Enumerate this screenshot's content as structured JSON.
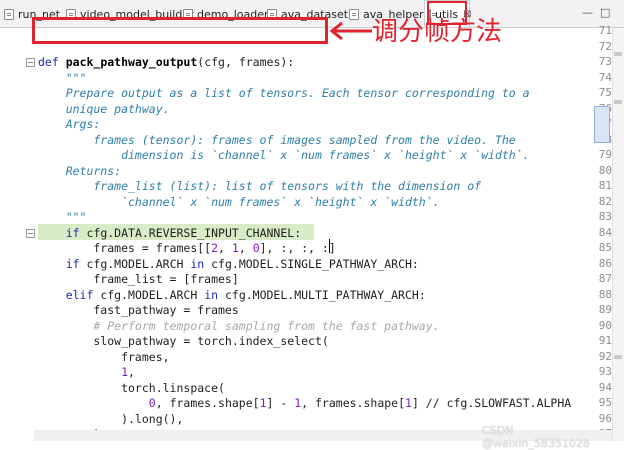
{
  "tabs": [
    {
      "label": "run_net",
      "active": false
    },
    {
      "label": "video_model_builder",
      "active": false
    },
    {
      "label": "demo_loader",
      "active": false
    },
    {
      "label": "ava_dataset",
      "active": false
    },
    {
      "label": "ava_helper",
      "active": false
    },
    {
      "label": "utils",
      "active": true,
      "close": "⊠"
    }
  ],
  "window_controls": {
    "minimize": "—",
    "maximize": "□"
  },
  "annotation": {
    "text": "调分帧方法",
    "color": "#e0242f"
  },
  "watermark": "CSDN @weixin_58351028",
  "colors": {
    "keyword": "#1e2bb8",
    "docstring": "#2f7fa8",
    "number": "#7a1fbf",
    "annotation_red": "#e0242f",
    "highlight": "#d7ecc7"
  },
  "editor": {
    "lines": [
      {
        "num": "71",
        "text": ""
      },
      {
        "num": "72",
        "text": ""
      },
      {
        "num": "73",
        "text": "def pack_pathway_output(cfg, frames):"
      },
      {
        "num": "74",
        "text": "    \"\"\""
      },
      {
        "num": "75",
        "text": "    Prepare output as a list of tensors. Each tensor corresponding to a"
      },
      {
        "num": "76",
        "text": "    unique pathway."
      },
      {
        "num": "77",
        "text": "    Args:"
      },
      {
        "num": "78",
        "text": "        frames (tensor): frames of images sampled from the video. The"
      },
      {
        "num": "79",
        "text": "            dimension is `channel` x `num frames` x `height` x `width`."
      },
      {
        "num": "80",
        "text": "    Returns:"
      },
      {
        "num": "81",
        "text": "        frame_list (list): list of tensors with the dimension of"
      },
      {
        "num": "82",
        "text": "            `channel` x `num frames` x `height` x `width`."
      },
      {
        "num": "83",
        "text": "    \"\"\""
      },
      {
        "num": "84",
        "text": "    if cfg.DATA.REVERSE_INPUT_CHANNEL:"
      },
      {
        "num": "85",
        "text": "        frames = frames[[2, 1, 0], :, :, :]"
      },
      {
        "num": "86",
        "text": "    if cfg.MODEL.ARCH in cfg.MODEL.SINGLE_PATHWAY_ARCH:"
      },
      {
        "num": "87",
        "text": "        frame_list = [frames]"
      },
      {
        "num": "88",
        "text": "    elif cfg.MODEL.ARCH in cfg.MODEL.MULTI_PATHWAY_ARCH:"
      },
      {
        "num": "89",
        "text": "        fast_pathway = frames"
      },
      {
        "num": "90",
        "text": "        # Perform temporal sampling from the fast pathway."
      },
      {
        "num": "91",
        "text": "        slow_pathway = torch.index_select("
      },
      {
        "num": "92",
        "text": "            frames,"
      },
      {
        "num": "93",
        "text": "            1,"
      },
      {
        "num": "94",
        "text": "            torch.linspace("
      },
      {
        "num": "95",
        "text": "                0, frames.shape[1] - 1, frames.shape[1] // cfg.SLOWFAST.ALPHA"
      },
      {
        "num": "96",
        "text": "            ).long(),"
      },
      {
        "num": "97",
        "text": "        )"
      }
    ]
  }
}
